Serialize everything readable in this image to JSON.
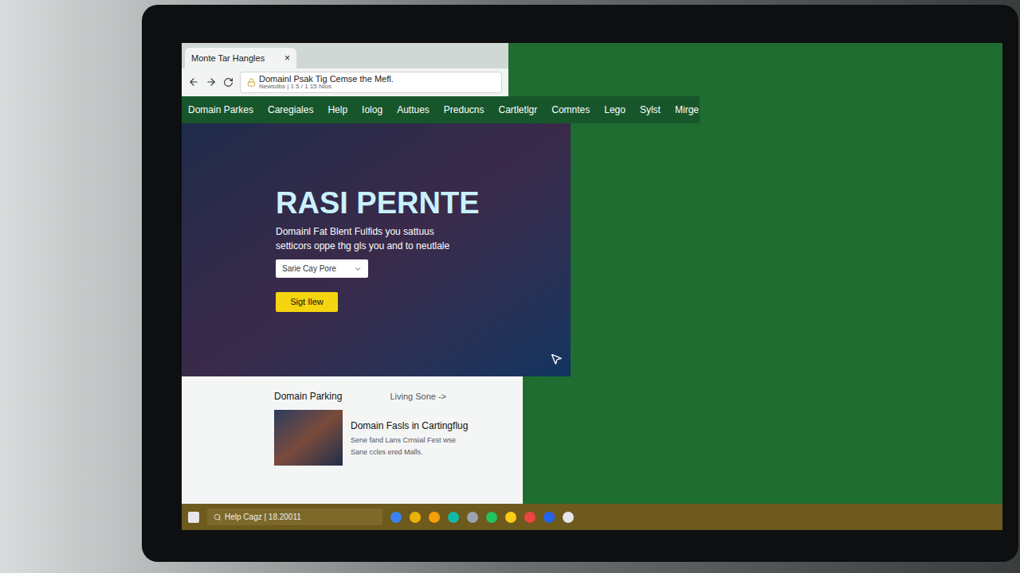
{
  "browser": {
    "tab": {
      "title": "Monte Tar Hangles",
      "close": "×"
    },
    "address": {
      "url": "Domainl Psak Tig Cemse the Mefl.",
      "subline": "Newsdbs | 1 5 / 1 15 Nlos"
    }
  },
  "nav": {
    "items": [
      "Domain Parkes",
      "Caregiales",
      "Help",
      "Iolog",
      "Auttues",
      "Preducns",
      "Cartletlgr",
      "Comntes",
      "Lego",
      "Sylst",
      "Mirge"
    ]
  },
  "hero": {
    "title": "RASI PERNTE",
    "subtitle": [
      "Domainl Fat Blent Fulfids you sattuus",
      "setticors oppe thg gls you and to neutlale"
    ],
    "select": "Sarie Cay Pore",
    "button": "Sigt Ilew"
  },
  "section": {
    "title": "Domain Parking",
    "link": "Living Sone ->",
    "card": {
      "title": "Domain Fasls in Cartingflug",
      "lines": [
        "Sene fand Lans Crnsial Fest wse",
        "Sane ccles ered Malls."
      ]
    }
  },
  "taskbar": {
    "search": "Help Cagz | 18.20011"
  }
}
